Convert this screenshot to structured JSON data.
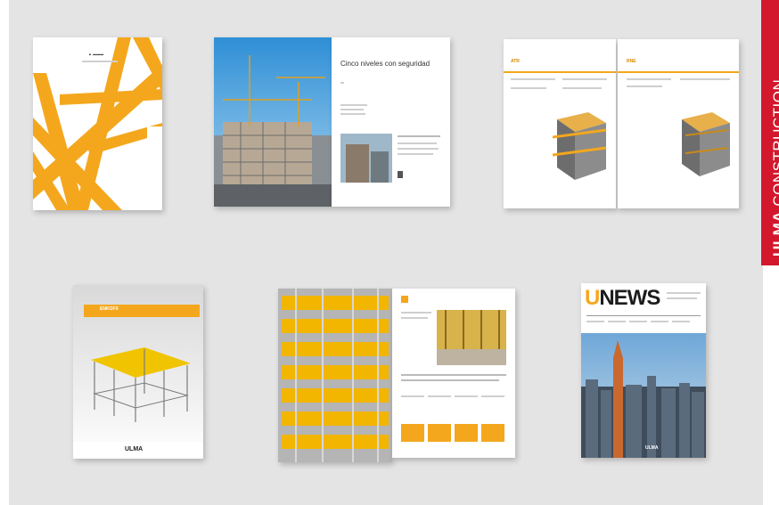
{
  "brand": {
    "bold": "ULMA",
    "light": "CONSTRUCTION",
    "color": "#d3172c"
  },
  "accent_color": "#f4a71d",
  "spread2": {
    "heading": "Cinco niveles con seguridad"
  },
  "spread3": {
    "left_code": "ATR",
    "right_code": "RNE"
  },
  "brochure4": {
    "header": "ENKOFX",
    "footer_logo": "ULMA"
  },
  "unews": {
    "title_accent": "U",
    "title_rest": "NEWS",
    "footer_logo": "ULMA"
  }
}
